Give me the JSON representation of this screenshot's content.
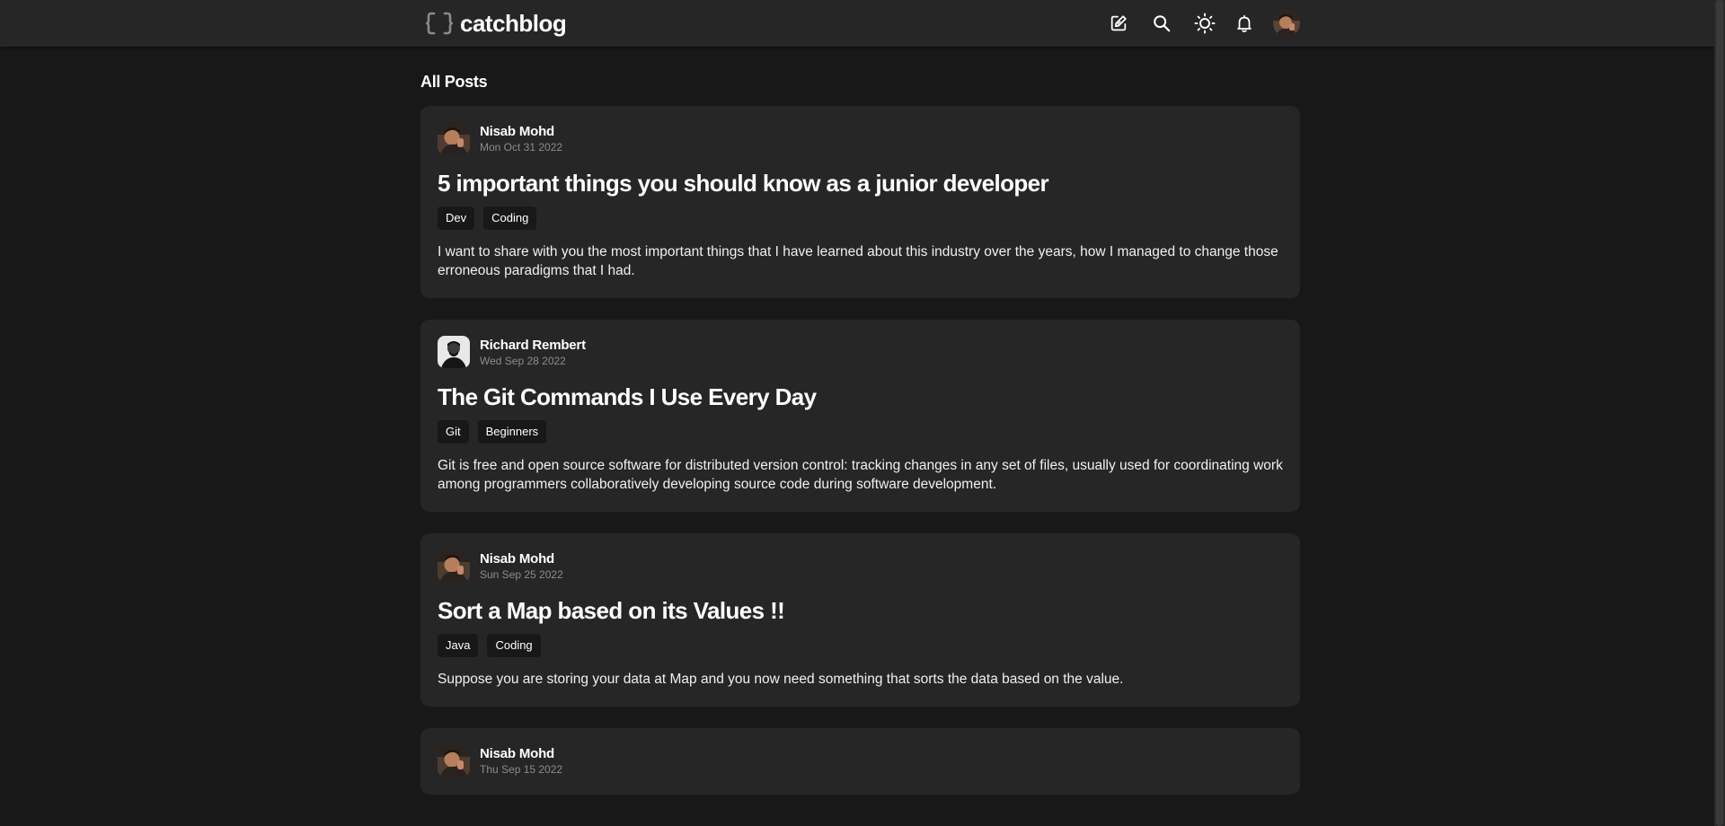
{
  "app": {
    "brand": "catchblog",
    "colors": {
      "background": "#181818",
      "surface": "#262626",
      "text": "#ffffff",
      "muted": "#8c8c8c"
    }
  },
  "header": {
    "icons": [
      "brackets-logo-icon",
      "edit-icon",
      "search-icon",
      "sun-icon",
      "bell-icon",
      "avatar"
    ]
  },
  "main": {
    "section_title": "All Posts",
    "posts": [
      {
        "author": "Nisab Mohd",
        "date": "Mon Oct 31 2022",
        "title": "5 important things you should know as a junior developer",
        "tags": [
          "Dev",
          "Coding"
        ],
        "excerpt": "I want to share with you the most important things that I have learned about this industry over the years, how I managed to change those erroneous paradigms that I had."
      },
      {
        "author": "Richard Rembert",
        "date": "Wed Sep 28 2022",
        "title": "The Git Commands I Use Every Day",
        "tags": [
          "Git",
          "Beginners"
        ],
        "excerpt": "Git is free and open source software for distributed version control: tracking changes in any set of files, usually used for coordinating work among programmers collaboratively developing source code during software development."
      },
      {
        "author": "Nisab Mohd",
        "date": "Sun Sep 25 2022",
        "title": "Sort a Map based on its Values !!",
        "tags": [
          "Java",
          "Coding"
        ],
        "excerpt": "Suppose you are storing your data at Map and you now need something that sorts the data based on the value."
      },
      {
        "author": "Nisab Mohd",
        "date": "Thu Sep 15 2022"
      }
    ]
  }
}
